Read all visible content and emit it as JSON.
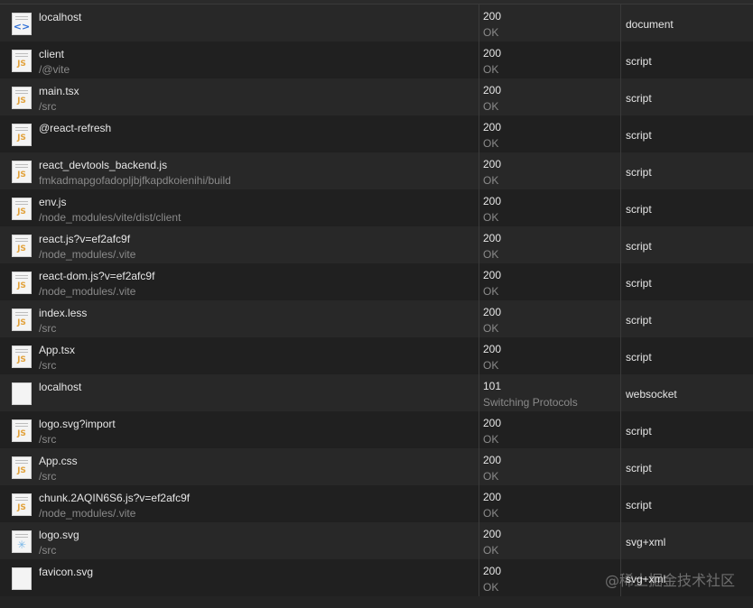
{
  "requests": [
    {
      "icon": "html-document-icon",
      "glyph": "<>",
      "kind": "doc",
      "name": "localhost",
      "path": "",
      "status": "200",
      "status_text": "OK",
      "type": "document"
    },
    {
      "icon": "js-file-icon",
      "glyph": "JS",
      "kind": "js",
      "name": "client",
      "path": "/@vite",
      "status": "200",
      "status_text": "OK",
      "type": "script"
    },
    {
      "icon": "js-file-icon",
      "glyph": "JS",
      "kind": "js",
      "name": "main.tsx",
      "path": "/src",
      "status": "200",
      "status_text": "OK",
      "type": "script"
    },
    {
      "icon": "js-file-icon",
      "glyph": "JS",
      "kind": "js",
      "name": "@react-refresh",
      "path": "",
      "status": "200",
      "status_text": "OK",
      "type": "script"
    },
    {
      "icon": "js-file-icon",
      "glyph": "JS",
      "kind": "js",
      "name": "react_devtools_backend.js",
      "path": "fmkadmapgofadopljbjfkapdkoienihi/build",
      "status": "200",
      "status_text": "OK",
      "type": "script"
    },
    {
      "icon": "js-file-icon",
      "glyph": "JS",
      "kind": "js",
      "name": "env.js",
      "path": "/node_modules/vite/dist/client",
      "status": "200",
      "status_text": "OK",
      "type": "script"
    },
    {
      "icon": "js-file-icon",
      "glyph": "JS",
      "kind": "js",
      "name": "react.js?v=ef2afc9f",
      "path": "/node_modules/.vite",
      "status": "200",
      "status_text": "OK",
      "type": "script"
    },
    {
      "icon": "js-file-icon",
      "glyph": "JS",
      "kind": "js",
      "name": "react-dom.js?v=ef2afc9f",
      "path": "/node_modules/.vite",
      "status": "200",
      "status_text": "OK",
      "type": "script"
    },
    {
      "icon": "js-file-icon",
      "glyph": "JS",
      "kind": "js",
      "name": "index.less",
      "path": "/src",
      "status": "200",
      "status_text": "OK",
      "type": "script"
    },
    {
      "icon": "js-file-icon",
      "glyph": "JS",
      "kind": "js",
      "name": "App.tsx",
      "path": "/src",
      "status": "200",
      "status_text": "OK",
      "type": "script"
    },
    {
      "icon": "blank-file-icon",
      "glyph": "",
      "kind": "blank",
      "name": "localhost",
      "path": "",
      "status": "101",
      "status_text": "Switching Protocols",
      "type": "websocket"
    },
    {
      "icon": "js-file-icon",
      "glyph": "JS",
      "kind": "js",
      "name": "logo.svg?import",
      "path": "/src",
      "status": "200",
      "status_text": "OK",
      "type": "script"
    },
    {
      "icon": "js-file-icon",
      "glyph": "JS",
      "kind": "js",
      "name": "App.css",
      "path": "/src",
      "status": "200",
      "status_text": "OK",
      "type": "script"
    },
    {
      "icon": "js-file-icon",
      "glyph": "JS",
      "kind": "js",
      "name": "chunk.2AQIN6S6.js?v=ef2afc9f",
      "path": "/node_modules/.vite",
      "status": "200",
      "status_text": "OK",
      "type": "script"
    },
    {
      "icon": "svg-image-icon",
      "glyph": "✳",
      "kind": "svgimg",
      "name": "logo.svg",
      "path": "/src",
      "status": "200",
      "status_text": "OK",
      "type": "svg+xml"
    },
    {
      "icon": "blank-file-icon",
      "glyph": "",
      "kind": "blank",
      "name": "favicon.svg",
      "path": "",
      "status": "200",
      "status_text": "OK",
      "type": "svg+xml"
    }
  ],
  "watermark": "@稀土掘金技术社区"
}
